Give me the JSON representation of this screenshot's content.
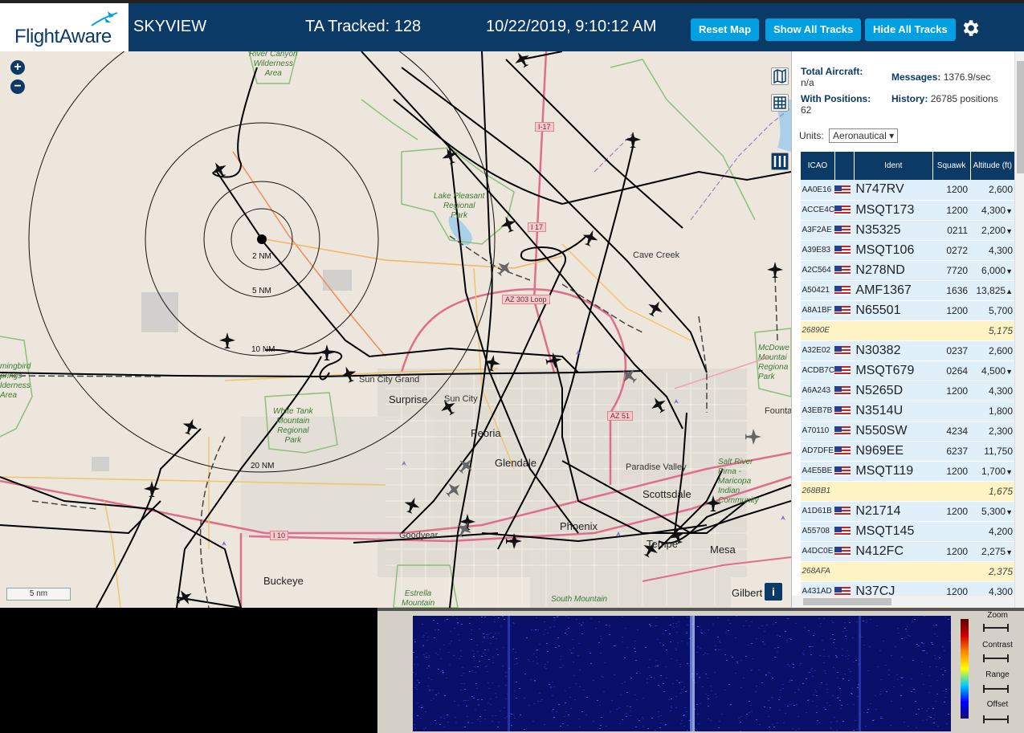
{
  "header": {
    "logo_text": "FlightAware",
    "app_name": "SKYVIEW",
    "ta_tracked": "TA Tracked: 128",
    "datetime": "10/22/2019, 9:10:12 AM",
    "buttons": {
      "reset_map": "Reset Map",
      "show_all_tracks": "Show All Tracks",
      "hide_all_tracks": "Hide All Tracks"
    },
    "settings_icon": "gear-icon"
  },
  "map": {
    "labels": {
      "ring_2": "2 NM",
      "ring_5": "5 NM",
      "ring_10": "10 NM",
      "ring_20": "20 NM",
      "i17": "I-17",
      "i17b": "I 17",
      "az303": "AZ 303 Loop",
      "az51": "AZ 51",
      "i10": "I 10",
      "cave_creek": "Cave Creek",
      "sun_city_grand": "Sun City Grand",
      "surprise": "Surprise",
      "sun_city": "Sun City",
      "peoria": "Peoria",
      "glendale": "Glendale",
      "paradise_valley": "Paradise Valley",
      "scottsdale": "Scottsdale",
      "phoenix": "Phoenix",
      "tempe": "Tempe",
      "mesa": "Mesa",
      "goodyear": "Goodyear",
      "buckeye": "Buckeye",
      "gilbert": "Gilbert",
      "south_mountain": "South Mountain",
      "fountain": "Founta",
      "lake_pleasant": "Lake Pleasant\nRegional\nPark",
      "hells_canyon": "River Canyon\nWilderness\nArea",
      "white_tank": "White Tank\nMountain\nRegional\nPark",
      "mcdowell": "McDowe\nMountai\nRegiona\nPark",
      "hummingbird": "mingbird\nprings\nlderness\nArea",
      "salt_river": "Salt River\nPima -\nMaricopa\nIndian\nCommunity",
      "estrella": "Estrella\nMountain"
    },
    "scale_label": "5 nm",
    "zoom_in": "+",
    "zoom_out": "−",
    "info": "i"
  },
  "sidebar": {
    "total_aircraft_label": "Total Aircraft:",
    "total_aircraft_value": "n/a",
    "messages_label": "Messages:",
    "messages_value": "1376.9/sec",
    "with_positions_label": "With Positions:",
    "with_positions_value": "62",
    "history_label": "History:",
    "history_value": "26785 positions",
    "units_label": "Units:",
    "units_value": "Aeronautical",
    "columns": [
      "ICAO",
      "",
      "Ident",
      "Squawk",
      "Altitude (ft)"
    ],
    "rows": [
      {
        "icao": "AA0E16",
        "flag": true,
        "ident": "N747RV",
        "squawk": "1200",
        "alt": "2,600",
        "trend": "",
        "alt_row": false
      },
      {
        "icao": "ACCE4C",
        "flag": true,
        "ident": "MSQT173",
        "squawk": "1200",
        "alt": "4,300",
        "trend": "▼",
        "alt_row": false
      },
      {
        "icao": "A3F2AE",
        "flag": true,
        "ident": "N35325",
        "squawk": "0211",
        "alt": "2,200",
        "trend": "▼",
        "alt_row": false
      },
      {
        "icao": "A39E83",
        "flag": true,
        "ident": "MSQT106",
        "squawk": "0272",
        "alt": "4,300",
        "trend": "",
        "alt_row": false
      },
      {
        "icao": "A2C564",
        "flag": true,
        "ident": "N278ND",
        "squawk": "7720",
        "alt": "6,000",
        "trend": "▼",
        "alt_row": false
      },
      {
        "icao": "A50421",
        "flag": true,
        "ident": "AMF1367",
        "squawk": "1636",
        "alt": "13,825",
        "trend": "▲",
        "alt_row": false
      },
      {
        "icao": "A8A1BF",
        "flag": true,
        "ident": "N65501",
        "squawk": "1200",
        "alt": "5,700",
        "trend": "",
        "alt_row": false
      },
      {
        "icao": "26890E",
        "flag": false,
        "ident": "",
        "squawk": "",
        "alt": "5,175",
        "trend": "",
        "alt_row": true
      },
      {
        "icao": "A32E02",
        "flag": true,
        "ident": "N30382",
        "squawk": "0237",
        "alt": "2,600",
        "trend": "",
        "alt_row": false
      },
      {
        "icao": "ACDB7C",
        "flag": true,
        "ident": "MSQT679",
        "squawk": "0264",
        "alt": "4,500",
        "trend": "▼",
        "alt_row": false
      },
      {
        "icao": "A6A243",
        "flag": true,
        "ident": "N5265D",
        "squawk": "1200",
        "alt": "4,300",
        "trend": "",
        "alt_row": false
      },
      {
        "icao": "A3EB7B",
        "flag": true,
        "ident": "N3514U",
        "squawk": "",
        "alt": "1,800",
        "trend": "",
        "alt_row": false
      },
      {
        "icao": "A70110",
        "flag": true,
        "ident": "N550SW",
        "squawk": "4234",
        "alt": "2,300",
        "trend": "",
        "alt_row": false
      },
      {
        "icao": "AD7DFE",
        "flag": true,
        "ident": "N969EE",
        "squawk": "6237",
        "alt": "11,750",
        "trend": "",
        "alt_row": false
      },
      {
        "icao": "A4E5BE",
        "flag": true,
        "ident": "MSQT119",
        "squawk": "1200",
        "alt": "1,700",
        "trend": "▼",
        "alt_row": false
      },
      {
        "icao": "268BB1",
        "flag": false,
        "ident": "",
        "squawk": "",
        "alt": "1,675",
        "trend": "",
        "alt_row": true
      },
      {
        "icao": "A1D61B",
        "flag": true,
        "ident": "N21714",
        "squawk": "1200",
        "alt": "5,300",
        "trend": "▼",
        "alt_row": false
      },
      {
        "icao": "A55708",
        "flag": true,
        "ident": "MSQT145",
        "squawk": "",
        "alt": "4,200",
        "trend": "",
        "alt_row": false
      },
      {
        "icao": "A4DC0E",
        "flag": true,
        "ident": "N412FC",
        "squawk": "1200",
        "alt": "2,275",
        "trend": "▼",
        "alt_row": false
      },
      {
        "icao": "268AFA",
        "flag": false,
        "ident": "",
        "squawk": "",
        "alt": "2,375",
        "trend": "",
        "alt_row": true
      },
      {
        "icao": "A431AD",
        "flag": true,
        "ident": "N37CJ",
        "squawk": "1200",
        "alt": "4,300",
        "trend": "",
        "alt_row": false
      }
    ]
  },
  "waterfall": {
    "controls": [
      "Zoom",
      "Contrast",
      "Range",
      "Offset"
    ]
  },
  "colors": {
    "brand": "#0b3a66",
    "button": "#00a0e2",
    "highlight_row": "#fdf3c4",
    "row": "#dff0fb"
  }
}
